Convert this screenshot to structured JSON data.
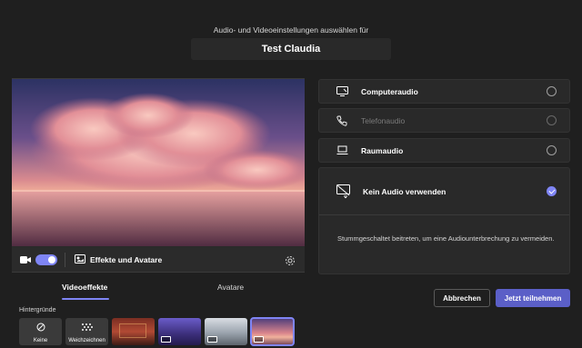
{
  "header": {
    "subtitle": "Audio- und Videoeinstellungen auswählen für",
    "meeting_name": "Test Claudia"
  },
  "video": {
    "camera_on": true,
    "effects_label": "Effekte und Avatare"
  },
  "tabs": [
    {
      "label": "Videoeffekte",
      "active": true
    },
    {
      "label": "Avatare",
      "active": false
    }
  ],
  "backgrounds": {
    "title": "Hintergründe",
    "items": [
      {
        "label": "Keine",
        "icon": "none-icon"
      },
      {
        "label": "Weichzeichnen",
        "icon": "blur-icon"
      },
      {
        "label": "",
        "kind": "image"
      },
      {
        "label": "",
        "kind": "video"
      },
      {
        "label": "",
        "kind": "video"
      },
      {
        "label": "",
        "kind": "video",
        "selected": true
      }
    ]
  },
  "audio_options": [
    {
      "label": "Computeraudio",
      "icon": "monitor-icon",
      "enabled": true,
      "selected": false
    },
    {
      "label": "Telefonaudio",
      "icon": "phone-icon",
      "enabled": false,
      "selected": false
    },
    {
      "label": "Raumaudio",
      "icon": "room-audio-icon",
      "enabled": true,
      "selected": false
    },
    {
      "label": "Kein Audio verwenden",
      "icon": "no-audio-icon",
      "enabled": true,
      "selected": true
    }
  ],
  "no_audio_description": "Stummgeschaltet beitreten, um eine Audiounterbrechung zu vermeiden.",
  "actions": {
    "cancel": "Abbrechen",
    "join": "Jetzt teilnehmen"
  },
  "colors": {
    "accent": "#7f85f5",
    "primary_button": "#5b5fc7",
    "background": "#1f1f1f",
    "panel": "#292929"
  }
}
